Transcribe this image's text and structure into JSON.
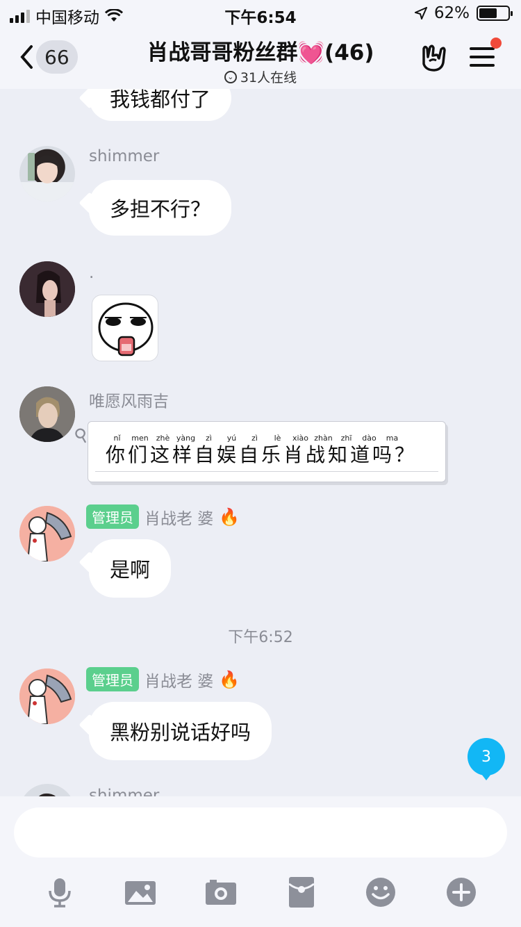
{
  "status_bar": {
    "carrier": "中国移动",
    "time": "下午6:54",
    "battery_percent": "62%",
    "battery_level": 0.62
  },
  "header": {
    "back_count": "66",
    "title": "肖战哥哥粉丝群💓(46)",
    "online_status": "31人在线",
    "icons": [
      "back-chevron-icon",
      "rock-hand-icon",
      "menu-icon"
    ]
  },
  "messages": [
    {
      "type": "text",
      "sender": "",
      "text": "我钱都付了"
    },
    {
      "type": "text",
      "sender": "shimmer",
      "text": "多担不行？"
    },
    {
      "type": "sticker",
      "sender": ".",
      "sticker": "meme-face-sticker"
    },
    {
      "type": "note",
      "sender": "唯愿风雨吉",
      "text": "你们这样自娱自乐肖战知道吗？",
      "pinyin": [
        "nǐ",
        "men",
        "zhè",
        "yàng",
        "zì",
        "yú",
        "zì",
        "lè",
        "xiào",
        "zhàn",
        "zhī",
        "dào",
        "ma"
      ]
    },
    {
      "type": "text",
      "badge": "管理员",
      "sender": "肖战老 婆",
      "sender_icon": "fire-emoji",
      "text": "是啊"
    },
    {
      "type": "text",
      "badge": "管理员",
      "sender": "肖战老 婆",
      "sender_icon": "fire-emoji",
      "text": "黑粉别说话好吗"
    },
    {
      "type": "partial",
      "sender": "shimmer"
    }
  ],
  "time_divider": "下午6:52",
  "new_message_count": "3",
  "input": {
    "placeholder": ""
  },
  "toolbar": [
    "microphone-icon",
    "image-icon",
    "camera-icon",
    "red-packet-icon",
    "emoji-icon",
    "plus-icon"
  ]
}
